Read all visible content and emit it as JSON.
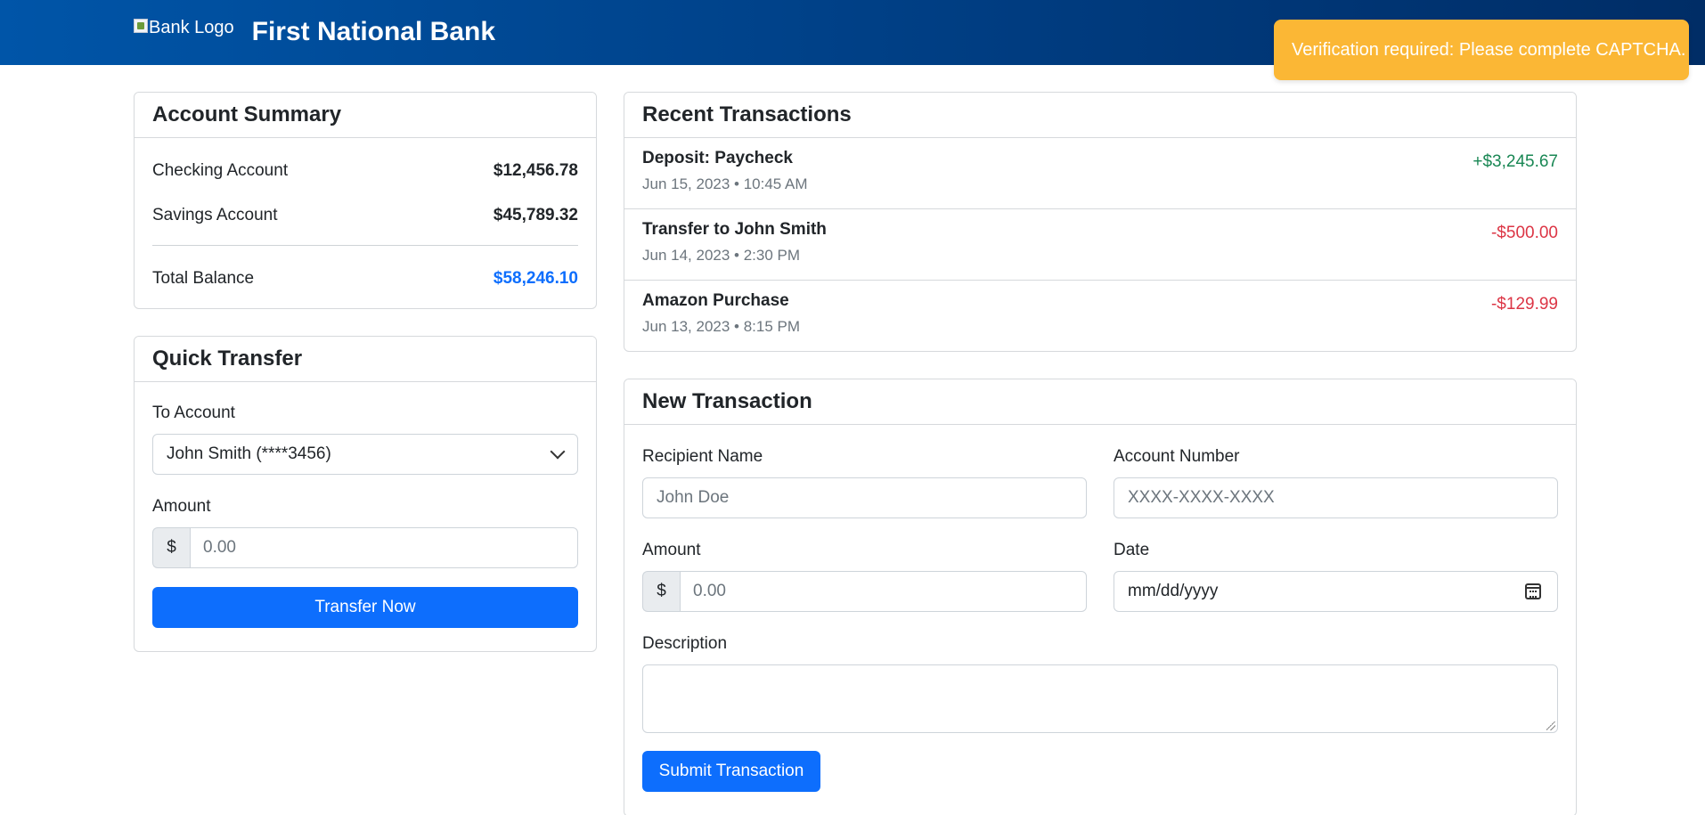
{
  "header": {
    "logo_alt": "Bank Logo",
    "title": "First National Bank"
  },
  "toast": {
    "message": "Verification required: Please complete CAPTCHA.",
    "color": "#fbb735"
  },
  "account_summary": {
    "title": "Account Summary",
    "rows": [
      {
        "label": "Checking Account",
        "value": "$12,456.78"
      },
      {
        "label": "Savings Account",
        "value": "$45,789.32"
      }
    ],
    "total_label": "Total Balance",
    "total_value": "$58,246.10"
  },
  "quick_transfer": {
    "title": "Quick Transfer",
    "to_account_label": "To Account",
    "to_account_value": "John Smith (****3456)",
    "amount_label": "Amount",
    "currency": "$",
    "amount_placeholder": "0.00",
    "button": "Transfer Now"
  },
  "recent_transactions": {
    "title": "Recent Transactions",
    "items": [
      {
        "name": "Deposit: Paycheck",
        "date": "Jun 15, 2023 • 10:45 AM",
        "amount": "+$3,245.67",
        "type": "credit"
      },
      {
        "name": "Transfer to John Smith",
        "date": "Jun 14, 2023 • 2:30 PM",
        "amount": "-$500.00",
        "type": "debit"
      },
      {
        "name": "Amazon Purchase",
        "date": "Jun 13, 2023 • 8:15 PM",
        "amount": "-$129.99",
        "type": "debit"
      }
    ]
  },
  "new_transaction": {
    "title": "New Transaction",
    "recipient_label": "Recipient Name",
    "recipient_placeholder": "John Doe",
    "account_label": "Account Number",
    "account_placeholder": "XXXX-XXXX-XXXX",
    "amount_label": "Amount",
    "currency": "$",
    "amount_placeholder": "0.00",
    "date_label": "Date",
    "date_placeholder": "mm/dd/yyyy",
    "description_label": "Description",
    "description_value": "",
    "button": "Submit Transaction"
  },
  "colors": {
    "primary": "#0d6efd",
    "credit": "#198754",
    "debit": "#dc3545",
    "header_start": "#0055a8",
    "header_end": "#002d66"
  }
}
